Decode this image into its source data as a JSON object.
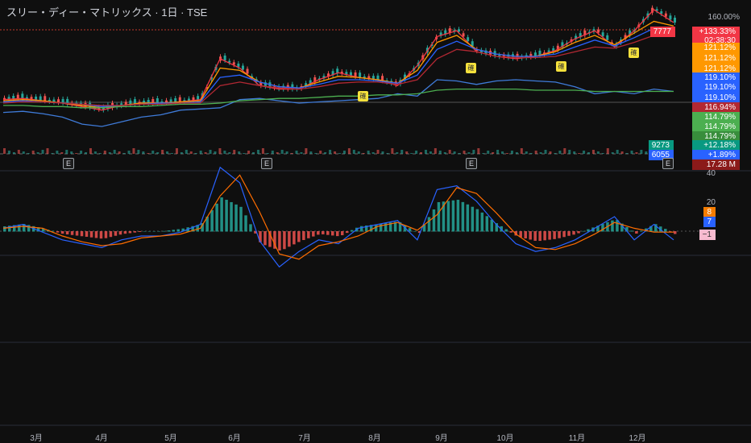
{
  "title": "スリー・ディー・マトリックス · 1日 · TSE",
  "price_scale": {
    "top_label": "160.00%",
    "vol_scale_label": "40",
    "macd_scale_label": "20"
  },
  "price_tags": [
    {
      "id": "last_price",
      "text": "7777",
      "bg": "#f23645"
    },
    {
      "id": "change",
      "text": "+133.33%",
      "bg": "#f23645"
    },
    {
      "id": "countdown",
      "text": "02:38:30",
      "bg": "#f23645"
    },
    {
      "id": "ma_orange_1",
      "text": "121.12%",
      "bg": "#ff9800"
    },
    {
      "id": "ma_orange_2",
      "text": "121.12%",
      "bg": "#ff9800"
    },
    {
      "id": "ma_orange_3",
      "text": "121.12%",
      "bg": "#ff9800"
    },
    {
      "id": "ma_blue_1",
      "text": "119.10%",
      "bg": "#2962ff"
    },
    {
      "id": "ma_blue_2",
      "text": "119.10%",
      "bg": "#2962ff"
    },
    {
      "id": "ma_blue_3",
      "text": "119.10%",
      "bg": "#2962ff"
    },
    {
      "id": "ma_red",
      "text": "116.94%",
      "bg": "#b22833"
    },
    {
      "id": "ma_green_1",
      "text": "114.79%",
      "bg": "#4caf50"
    },
    {
      "id": "ma_green_2",
      "text": "114.79%",
      "bg": "#4caf50"
    },
    {
      "id": "ma_green_3",
      "text": "114.79%",
      "bg": "#388e3c"
    }
  ],
  "volume_tags": [
    {
      "id": "vol_a",
      "label": "9273",
      "text": "+12.18%",
      "bg": "#089981"
    },
    {
      "id": "vol_b",
      "label": "6055",
      "text": "+1.89%",
      "bg": "#2962ff"
    },
    {
      "id": "vol_c",
      "label": "",
      "text": "17.28 M",
      "bg": "#8b1a1a"
    }
  ],
  "macd_tags": [
    {
      "id": "macd_signal",
      "text": "8",
      "bg": "#f57c00"
    },
    {
      "id": "macd_line",
      "text": "7",
      "bg": "#2962ff"
    },
    {
      "id": "macd_hist",
      "text": "−1",
      "bg": "#f8bbd0"
    }
  ],
  "earnings_marker": "E",
  "signal_marker": "確",
  "colors": {
    "up": "#26a69a",
    "down": "#ef5350",
    "macd": "#2962ff",
    "signal": "#ff6d00",
    "grid": "#2a2e39"
  },
  "chart_data": [
    {
      "type": "line",
      "title": "スリー・ディー・マトリックス · 1日 · TSE",
      "xlabel": "",
      "ylabel": "",
      "x_ticks": [
        "3月",
        "4月",
        "5月",
        "6月",
        "7月",
        "8月",
        "9月",
        "10月",
        "11月",
        "12月"
      ],
      "ylim": [
        -15,
        160
      ],
      "series": [
        {
          "values": [
            3,
            4,
            2,
            0,
            -3,
            -6,
            -2,
            0,
            0,
            1,
            3,
            38,
            30,
            15,
            12,
            12,
            20,
            26,
            22,
            20,
            15,
            32,
            57,
            62,
            44,
            40,
            38,
            40,
            45,
            55,
            62,
            48,
            62,
            80,
            69
          ]
        },
        {
          "values": [
            2,
            3,
            2,
            0,
            -2,
            -4,
            -2,
            0,
            0,
            1,
            2,
            30,
            28,
            18,
            14,
            13,
            18,
            23,
            22,
            20,
            17,
            28,
            52,
            58,
            46,
            42,
            40,
            40,
            44,
            52,
            58,
            50,
            60,
            70,
            66
          ]
        },
        {
          "values": [
            1,
            2,
            1,
            0,
            -1,
            -3,
            -2,
            -1,
            0,
            0,
            1,
            22,
            24,
            18,
            14,
            13,
            16,
            20,
            20,
            19,
            17,
            24,
            46,
            53,
            46,
            42,
            40,
            40,
            42,
            48,
            54,
            49,
            56,
            64,
            62
          ]
        },
        {
          "values": [
            0,
            1,
            1,
            0,
            -1,
            -2,
            -2,
            -1,
            -1,
            0,
            0,
            15,
            18,
            15,
            13,
            12,
            14,
            17,
            18,
            18,
            16,
            20,
            38,
            46,
            44,
            40,
            39,
            39,
            40,
            44,
            48,
            47,
            52,
            58,
            58
          ]
        },
        {
          "values": [
            -8,
            -7,
            -9,
            -12,
            -18,
            -20,
            -16,
            -12,
            -10,
            -6,
            -5,
            -4,
            3,
            4,
            2,
            0,
            1,
            2,
            3,
            4,
            8,
            6,
            20,
            19,
            16,
            19,
            20,
            19,
            18,
            14,
            8,
            10,
            8,
            12,
            10
          ]
        },
        {
          "values": [
            -2,
            -2,
            -3,
            -3,
            -4,
            -4,
            -3,
            -3,
            -2,
            -1,
            -1,
            0,
            2,
            3,
            4,
            4,
            5,
            6,
            6,
            7,
            7,
            8,
            11,
            12,
            12,
            12,
            12,
            11,
            11,
            11,
            10,
            10,
            10,
            10,
            10
          ]
        }
      ]
    },
    {
      "type": "bar",
      "title": "",
      "ylim": [
        -10,
        20
      ],
      "series": [
        {
          "values": [
            2,
            3,
            1,
            -1,
            -2,
            -3,
            -1,
            0,
            0,
            1,
            3,
            14,
            10,
            -5,
            -8,
            -4,
            -1,
            -2,
            2,
            3,
            4,
            -1,
            12,
            13,
            9,
            3,
            -2,
            -4,
            -3,
            -1,
            2,
            5,
            -1,
            3,
            -1
          ]
        }
      ]
    }
  ]
}
